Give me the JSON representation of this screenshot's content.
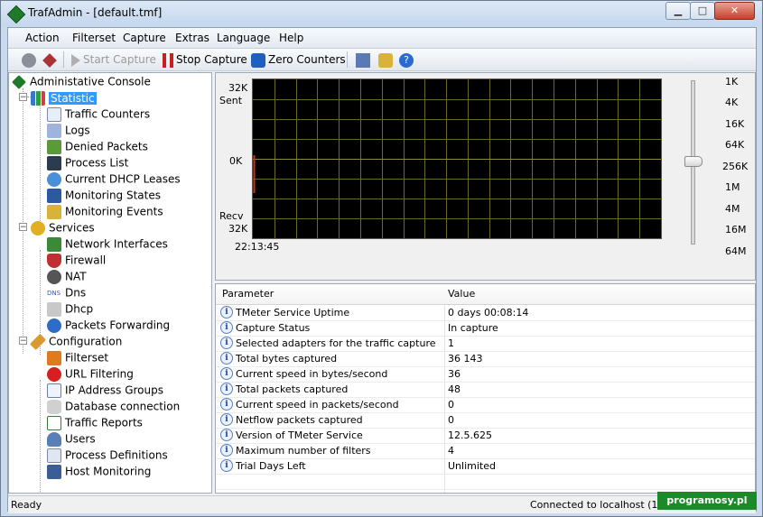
{
  "window": {
    "title": "TrafAdmin - [default.tmf]"
  },
  "menu": [
    "Action",
    "Filterset",
    "Capture",
    "Extras",
    "Language",
    "Help"
  ],
  "toolbar": {
    "start_capture": "Start Capture",
    "stop_capture": "Stop Capture",
    "zero_counters": "Zero Counters"
  },
  "tree": {
    "root": "Administative Console",
    "statistic": "Statistic",
    "statistic_items": [
      "Traffic Counters",
      "Logs",
      "Denied Packets",
      "Process List",
      "Current DHCP Leases",
      "Monitoring States",
      "Monitoring Events"
    ],
    "services": "Services",
    "services_items": [
      "Network Interfaces",
      "Firewall",
      "NAT",
      "Dns",
      "Dhcp",
      "Packets Forwarding"
    ],
    "configuration": "Configuration",
    "configuration_items": [
      "Filterset",
      "URL Filtering",
      "IP Address Groups",
      "Database connection",
      "Traffic Reports",
      "Users",
      "Process Definitions",
      "Host Monitoring"
    ]
  },
  "graph": {
    "sent_value": "32K",
    "sent_label": "Sent",
    "zero_label": "0K",
    "recv_label": "Recv",
    "recv_value": "32K",
    "time": "22:13:45",
    "scale": [
      "1K",
      "4K",
      "16K",
      "64K",
      "256K",
      "1M",
      "4M",
      "16M",
      "64M"
    ]
  },
  "grid": {
    "col_param": "Parameter",
    "col_value": "Value",
    "rows": [
      {
        "p": "TMeter Service Uptime",
        "v": "0 days 00:08:14"
      },
      {
        "p": "Capture Status",
        "v": "In capture"
      },
      {
        "p": "Selected adapters for the traffic capture",
        "v": "1"
      },
      {
        "p": "Total bytes captured",
        "v": "36 143"
      },
      {
        "p": "Current speed in bytes/second",
        "v": "36"
      },
      {
        "p": "Total packets captured",
        "v": "48"
      },
      {
        "p": "Current speed in packets/second",
        "v": "0"
      },
      {
        "p": "Netflow packets captured",
        "v": "0"
      },
      {
        "p": "Version of TMeter Service",
        "v": "12.5.625"
      },
      {
        "p": "Maximum number of filters",
        "v": "4"
      },
      {
        "p": "Trial Days Left",
        "v": "Unlimited"
      }
    ]
  },
  "status": {
    "left": "Ready",
    "right": "Connected to localhost (127.0.0"
  },
  "watermark": "programosy.pl"
}
